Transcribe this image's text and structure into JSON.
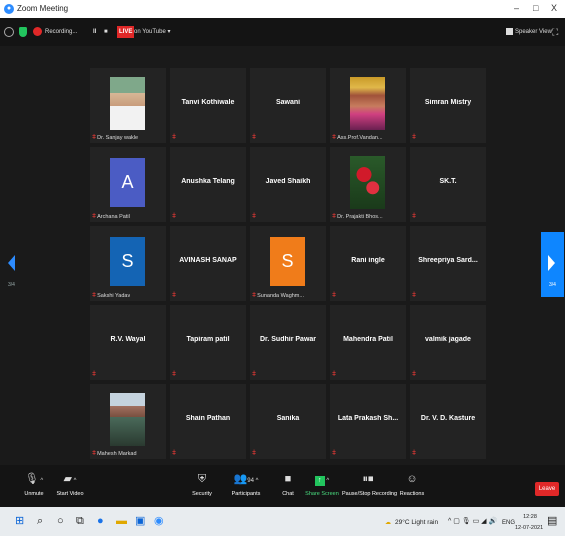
{
  "window": {
    "title": "Zoom Meeting",
    "minimize": "–",
    "maximize": "□",
    "close": "X"
  },
  "meeting": {
    "recording": "Recording...",
    "pause": "II",
    "stop": "■",
    "live_badge": "LIVE",
    "live_target": "on YouTube ▾",
    "view": "Speaker View",
    "fullscreen": "⛶"
  },
  "gallery": {
    "page_left": "3/4",
    "page_right": "3/4",
    "tiles": [
      {
        "name": "",
        "label": "Dr. Sanjay wakle",
        "type": "photo"
      },
      {
        "name": "Tanvi Kothiwale",
        "label": "",
        "type": "text"
      },
      {
        "name": "Sawani",
        "label": "",
        "type": "text"
      },
      {
        "name": "",
        "label": "Ass.Prof.Vandan...",
        "type": "photo"
      },
      {
        "name": "Simran Mistry",
        "label": "",
        "type": "text"
      },
      {
        "name": "",
        "label": "Archana Patil",
        "type": "avatar",
        "initial": "A",
        "color": "#4b5cc4"
      },
      {
        "name": "Anushka Telang",
        "label": "",
        "type": "text"
      },
      {
        "name": "Javed Shaikh",
        "label": "",
        "type": "text"
      },
      {
        "name": "",
        "label": "Dr. Prajakti Bhos...",
        "type": "photo"
      },
      {
        "name": "SK.T.",
        "label": "",
        "type": "text"
      },
      {
        "name": "",
        "label": "Sakshi Yadav",
        "type": "avatar",
        "initial": "S",
        "color": "#1464b4"
      },
      {
        "name": "AVINASH SANAP",
        "label": "",
        "type": "text"
      },
      {
        "name": "",
        "label": "Sunanda Waghm...",
        "type": "avatar",
        "initial": "S",
        "color": "#f07c1a"
      },
      {
        "name": "Rani ingle",
        "label": "",
        "type": "text"
      },
      {
        "name": "Shreepriya  Sard...",
        "label": "",
        "type": "text"
      },
      {
        "name": "R.V. Wayal",
        "label": "",
        "type": "text"
      },
      {
        "name": "Tapiram patil",
        "label": "",
        "type": "text"
      },
      {
        "name": "Dr. Sudhir Pawar",
        "label": "",
        "type": "text"
      },
      {
        "name": "Mahendra Patil",
        "label": "",
        "type": "text"
      },
      {
        "name": "valmik jagade",
        "label": "",
        "type": "text"
      },
      {
        "name": "",
        "label": "Mahesh Markad",
        "type": "photo"
      },
      {
        "name": "Shain Pathan",
        "label": "",
        "type": "text"
      },
      {
        "name": "Sanika",
        "label": "",
        "type": "text"
      },
      {
        "name": "Lata Prakash Sh...",
        "label": "",
        "type": "text"
      },
      {
        "name": "Dr. V. D. Kasture",
        "label": "",
        "type": "text"
      }
    ]
  },
  "toolbar": {
    "unmute": "Unmute",
    "start_video": "Start Video",
    "security": "Security",
    "participants": "Participants",
    "participants_count": "94",
    "chat": "Chat",
    "share_screen": "Share Screen",
    "pause_stop": "Pause/Stop Recording",
    "reactions": "Reactions",
    "leave": "Leave",
    "share_color": "#22c55e"
  },
  "taskbar": {
    "weather": "29°C  Light rain",
    "lang": "ENG",
    "time": "12:28",
    "date": "12-07-2021"
  }
}
